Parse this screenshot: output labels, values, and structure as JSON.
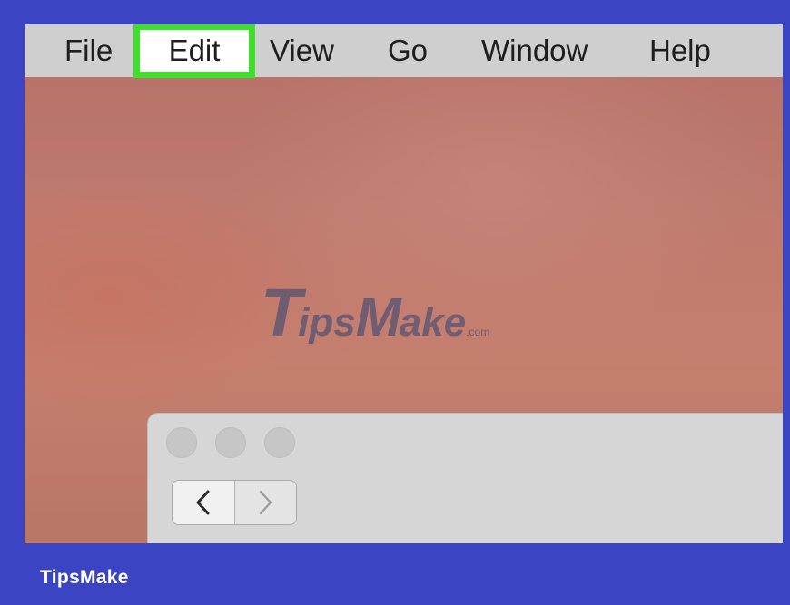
{
  "menubar": {
    "items": [
      {
        "label": "File"
      },
      {
        "label": "Edit",
        "highlighted": true,
        "highlight_color": "#3ee02c"
      },
      {
        "label": "View"
      },
      {
        "label": "Go"
      },
      {
        "label": "Window"
      },
      {
        "label": "Help"
      }
    ]
  },
  "watermark": {
    "logo_text": "TipsMake.com",
    "logo_part_t": "T",
    "logo_part_ips": "ips",
    "logo_part_m": "M",
    "logo_part_ake": "ake",
    "logo_part_com": ".com"
  },
  "finder_window": {
    "traffic_lights": [
      "close",
      "minimize",
      "zoom"
    ],
    "back_icon": "chevron-left-icon",
    "forward_icon": "chevron-right-icon"
  },
  "footer": {
    "brand": "TipsMake"
  },
  "colors": {
    "frame": "#3b45c3",
    "menubar": "#cfcfcf",
    "highlight": "#3ee02c",
    "desktop": "#bf7a6e"
  }
}
